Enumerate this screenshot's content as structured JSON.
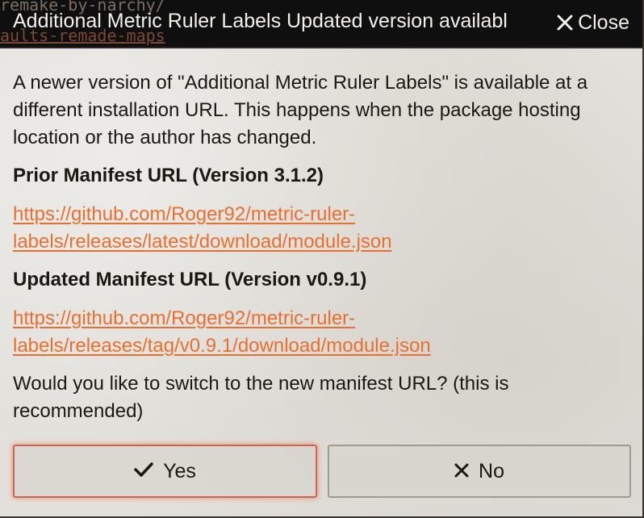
{
  "window": {
    "title": "Additional Metric Ruler Labels Updated version availabl",
    "close_label": "Close",
    "background_text_top": "remake-by-narchy/",
    "background_text_link": "aults-remade-maps"
  },
  "body": {
    "intro": "A newer version of \"Additional Metric Ruler Labels\" is available at a different installation URL. This happens when the package hosting location or the author has changed.",
    "prior_heading": "Prior Manifest URL (Version 3.1.2)",
    "prior_url": "https://github.com/Roger92/metric-ruler-labels/releases/latest/download/module.json",
    "updated_heading": "Updated Manifest URL (Version v0.9.1)",
    "updated_url": "https://github.com/Roger92/metric-ruler-labels/releases/tag/v0.9.1/download/module.json",
    "question": "Would you like to switch to the new manifest URL? (this is recommended)"
  },
  "buttons": {
    "yes_label": "Yes",
    "no_label": "No"
  },
  "colors": {
    "title_bar": "#0f0f0f",
    "link": "#e8702e",
    "focus_glow": "#ff6e46",
    "dialog_background": "#e3e1dc"
  },
  "icons": {
    "close": "close-icon",
    "yes": "check-icon",
    "no": "x-icon"
  }
}
